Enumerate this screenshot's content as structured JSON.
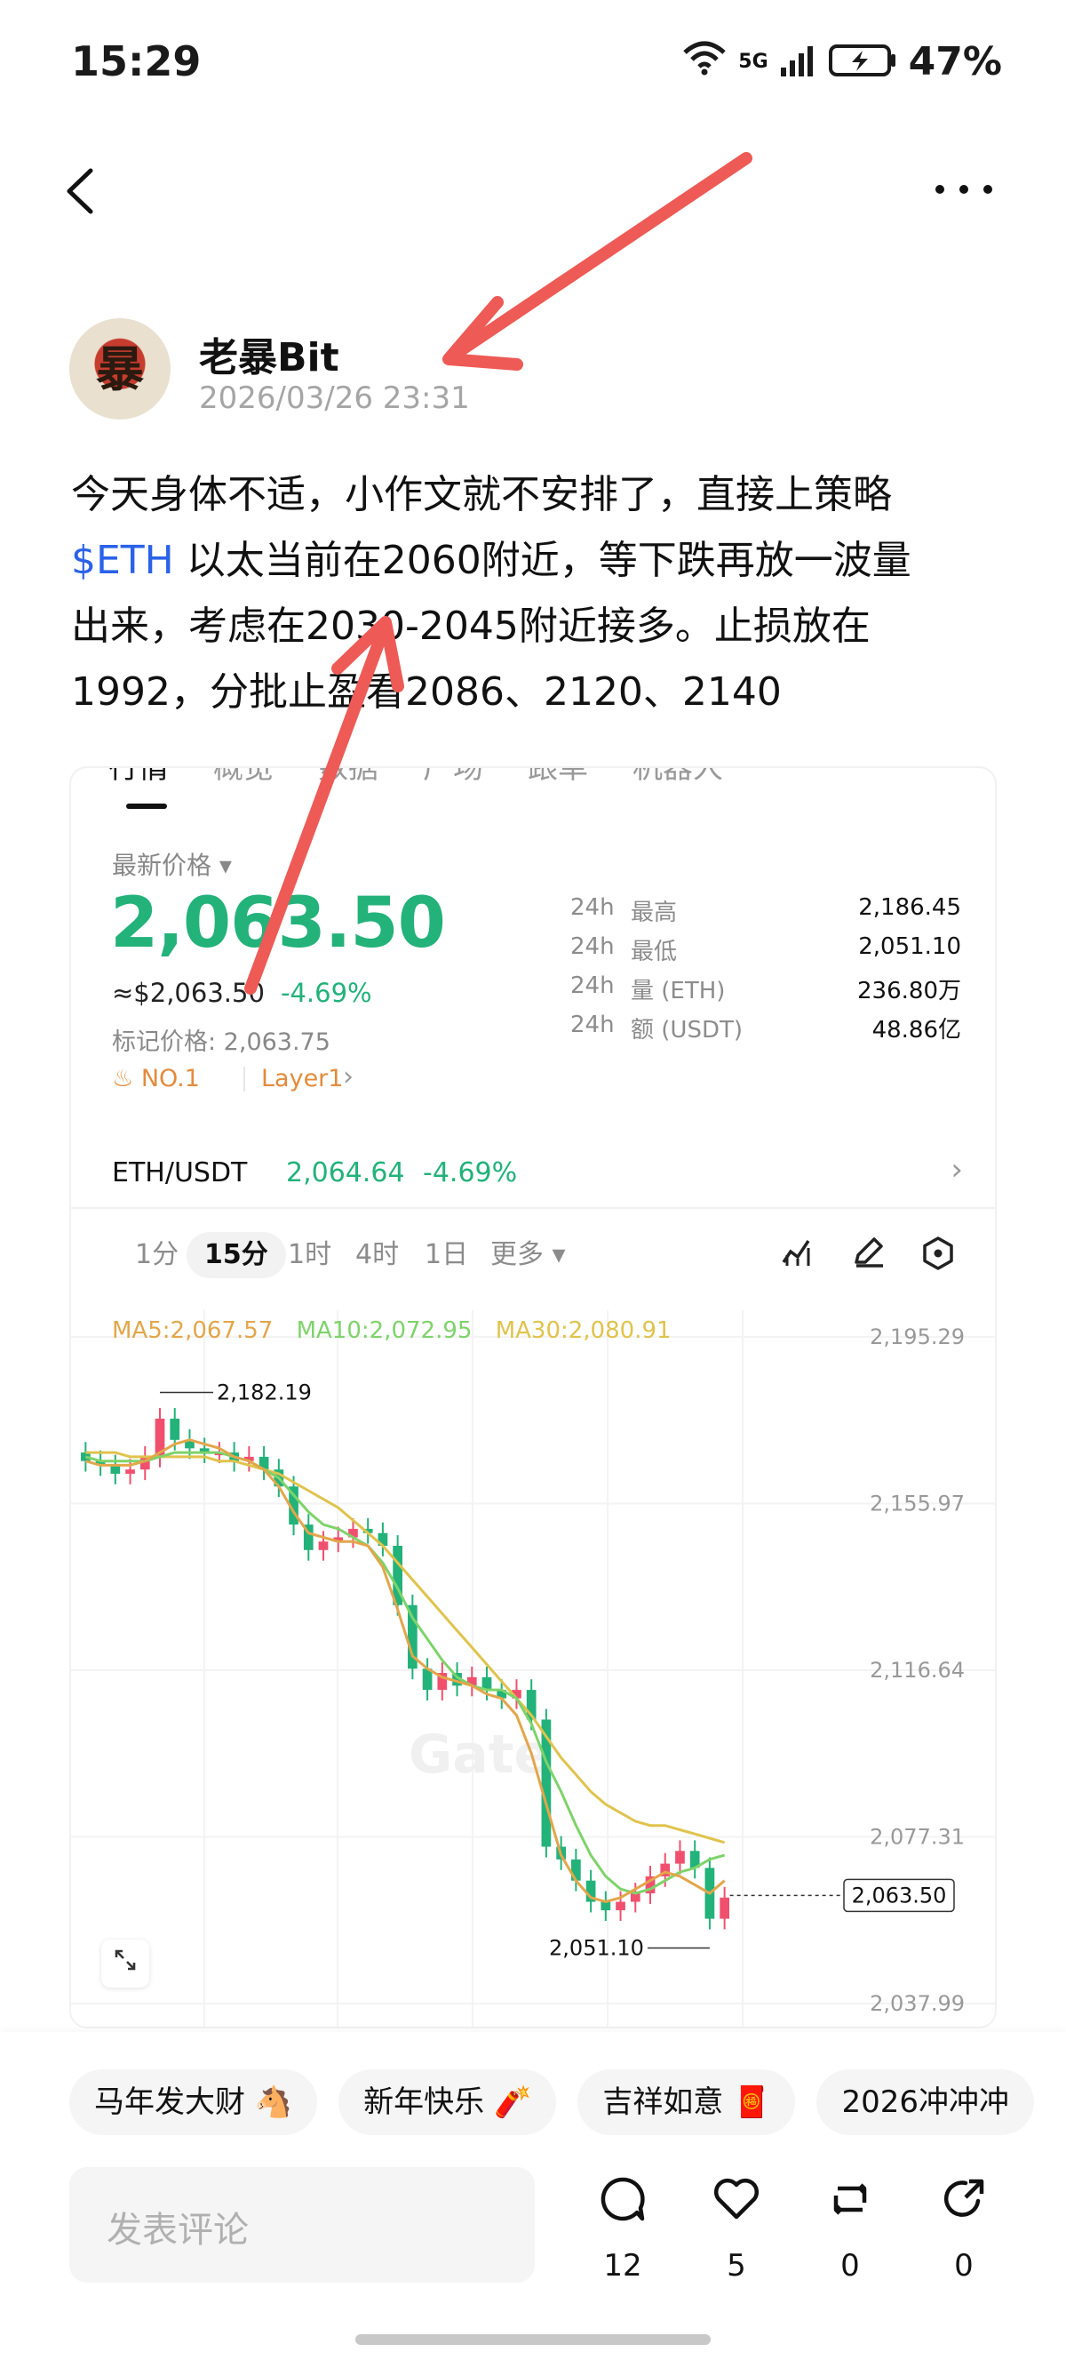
{
  "status_bar": {
    "time": "15:29",
    "network": "5G",
    "battery": "47%"
  },
  "nav": {
    "back_icon": "chevron-left-icon",
    "more_icon": "more-horizontal-icon"
  },
  "author": {
    "name": "老暴Bit",
    "avatar_text": "暴",
    "timestamp": "2026/03/26 23:31"
  },
  "post": {
    "line1": "今天身体不适，小作文就不安排了，直接上策略",
    "tag": "$ETH",
    "line2_rest": " 以太当前在2060附近，等下跌再放一波量",
    "line3": "出来，考虑在2030-2045附近接多。止损放在",
    "line4": "1992，分批止盈看2086、2120、2140"
  },
  "card": {
    "tabs": [
      "行情",
      "概览",
      "数据",
      "广场",
      "跟单",
      "机器人"
    ],
    "price_label": "最新价格",
    "price": "2,063.50",
    "price_usd": "≈$2,063.50",
    "change": "-4.69%",
    "mark_price": "标记价格: 2,063.75",
    "badge_rank": "NO.1",
    "badge_sector": "Layer1",
    "stats": [
      {
        "k1": "24h",
        "k2": "最高",
        "v": "2,186.45"
      },
      {
        "k1": "24h",
        "k2": "最低",
        "v": "2,051.10"
      },
      {
        "k1": "24h",
        "k2": "量 (ETH)",
        "v": "236.80万"
      },
      {
        "k1": "24h",
        "k2": "额 (USDT)",
        "v": "48.86亿"
      }
    ],
    "pair": {
      "name": "ETH/USDT",
      "price": "2,064.64",
      "change": "-4.69%"
    },
    "timeframes": [
      "1分",
      "15分",
      "1时",
      "4时",
      "1日",
      "更多 ▾"
    ],
    "active_timeframe": "15分",
    "ma": {
      "ma5": "MA5:2,067.57",
      "ma10": "MA10:2,072.95",
      "ma30": "MA30:2,080.91"
    },
    "watermark": "Gate"
  },
  "chart_data": {
    "type": "candlestick",
    "y_ticks": [
      "2,195.29",
      "2,155.97",
      "2,116.64",
      "2,077.31",
      "2,037.99"
    ],
    "ylim": [
      2037.99,
      2195.29
    ],
    "high_label": "2,182.19",
    "low_label": "2,051.10",
    "last_price_label": "2,063.50",
    "up_color": "#f0506e",
    "down_color": "#22b27a",
    "ma_colors": {
      "ma5": "#e3a64a",
      "ma10": "#7ed36a",
      "ma30": "#e0c34c"
    },
    "closes": [
      2166,
      2165,
      2163,
      2164,
      2167,
      2176,
      2171,
      2169,
      2168,
      2168,
      2166,
      2167,
      2164,
      2160,
      2151,
      2145,
      2147,
      2148,
      2150,
      2149,
      2146,
      2132,
      2117,
      2112,
      2116,
      2113,
      2115,
      2112,
      2110,
      2112,
      2105,
      2075,
      2072,
      2067,
      2062,
      2060,
      2062,
      2064,
      2068,
      2071,
      2074,
      2070,
      2058,
      2063
    ],
    "ma5": [
      2166,
      2165,
      2165,
      2165,
      2166,
      2168,
      2170,
      2171,
      2170,
      2169,
      2167,
      2166,
      2164,
      2160,
      2154,
      2149,
      2148,
      2147,
      2147,
      2146,
      2141,
      2131,
      2120,
      2117,
      2115,
      2114,
      2113,
      2111,
      2110,
      2106,
      2097,
      2085,
      2073,
      2067,
      2063,
      2062,
      2063,
      2065,
      2067,
      2069,
      2068,
      2066,
      2064,
      2067
    ],
    "ma10": [
      2167,
      2166,
      2166,
      2166,
      2166,
      2167,
      2168,
      2168,
      2168,
      2168,
      2167,
      2166,
      2164,
      2162,
      2158,
      2154,
      2151,
      2150,
      2148,
      2146,
      2142,
      2136,
      2129,
      2124,
      2119,
      2115,
      2113,
      2112,
      2112,
      2110,
      2104,
      2095,
      2088,
      2080,
      2073,
      2068,
      2065,
      2064,
      2065,
      2067,
      2069,
      2070,
      2072,
      2073
    ],
    "ma30": [
      2168,
      2168,
      2168,
      2167,
      2167,
      2167,
      2167,
      2167,
      2167,
      2166,
      2166,
      2165,
      2164,
      2163,
      2161,
      2159,
      2157,
      2155,
      2152,
      2149,
      2146,
      2142,
      2138,
      2134,
      2130,
      2126,
      2122,
      2118,
      2114,
      2110,
      2106,
      2101,
      2096,
      2092,
      2088,
      2085,
      2083,
      2081,
      2080,
      2080,
      2079,
      2078,
      2077,
      2076
    ]
  },
  "bottom": {
    "chips": [
      "马年发大财 🐴",
      "新年快乐 🧨",
      "吉祥如意 🧧",
      "2026冲冲冲"
    ],
    "comment_placeholder": "发表评论",
    "actions": [
      {
        "icon": "comment-icon",
        "count": "12"
      },
      {
        "icon": "heart-icon",
        "count": "5"
      },
      {
        "icon": "repost-icon",
        "count": "0"
      },
      {
        "icon": "share-icon",
        "count": "0"
      }
    ]
  }
}
